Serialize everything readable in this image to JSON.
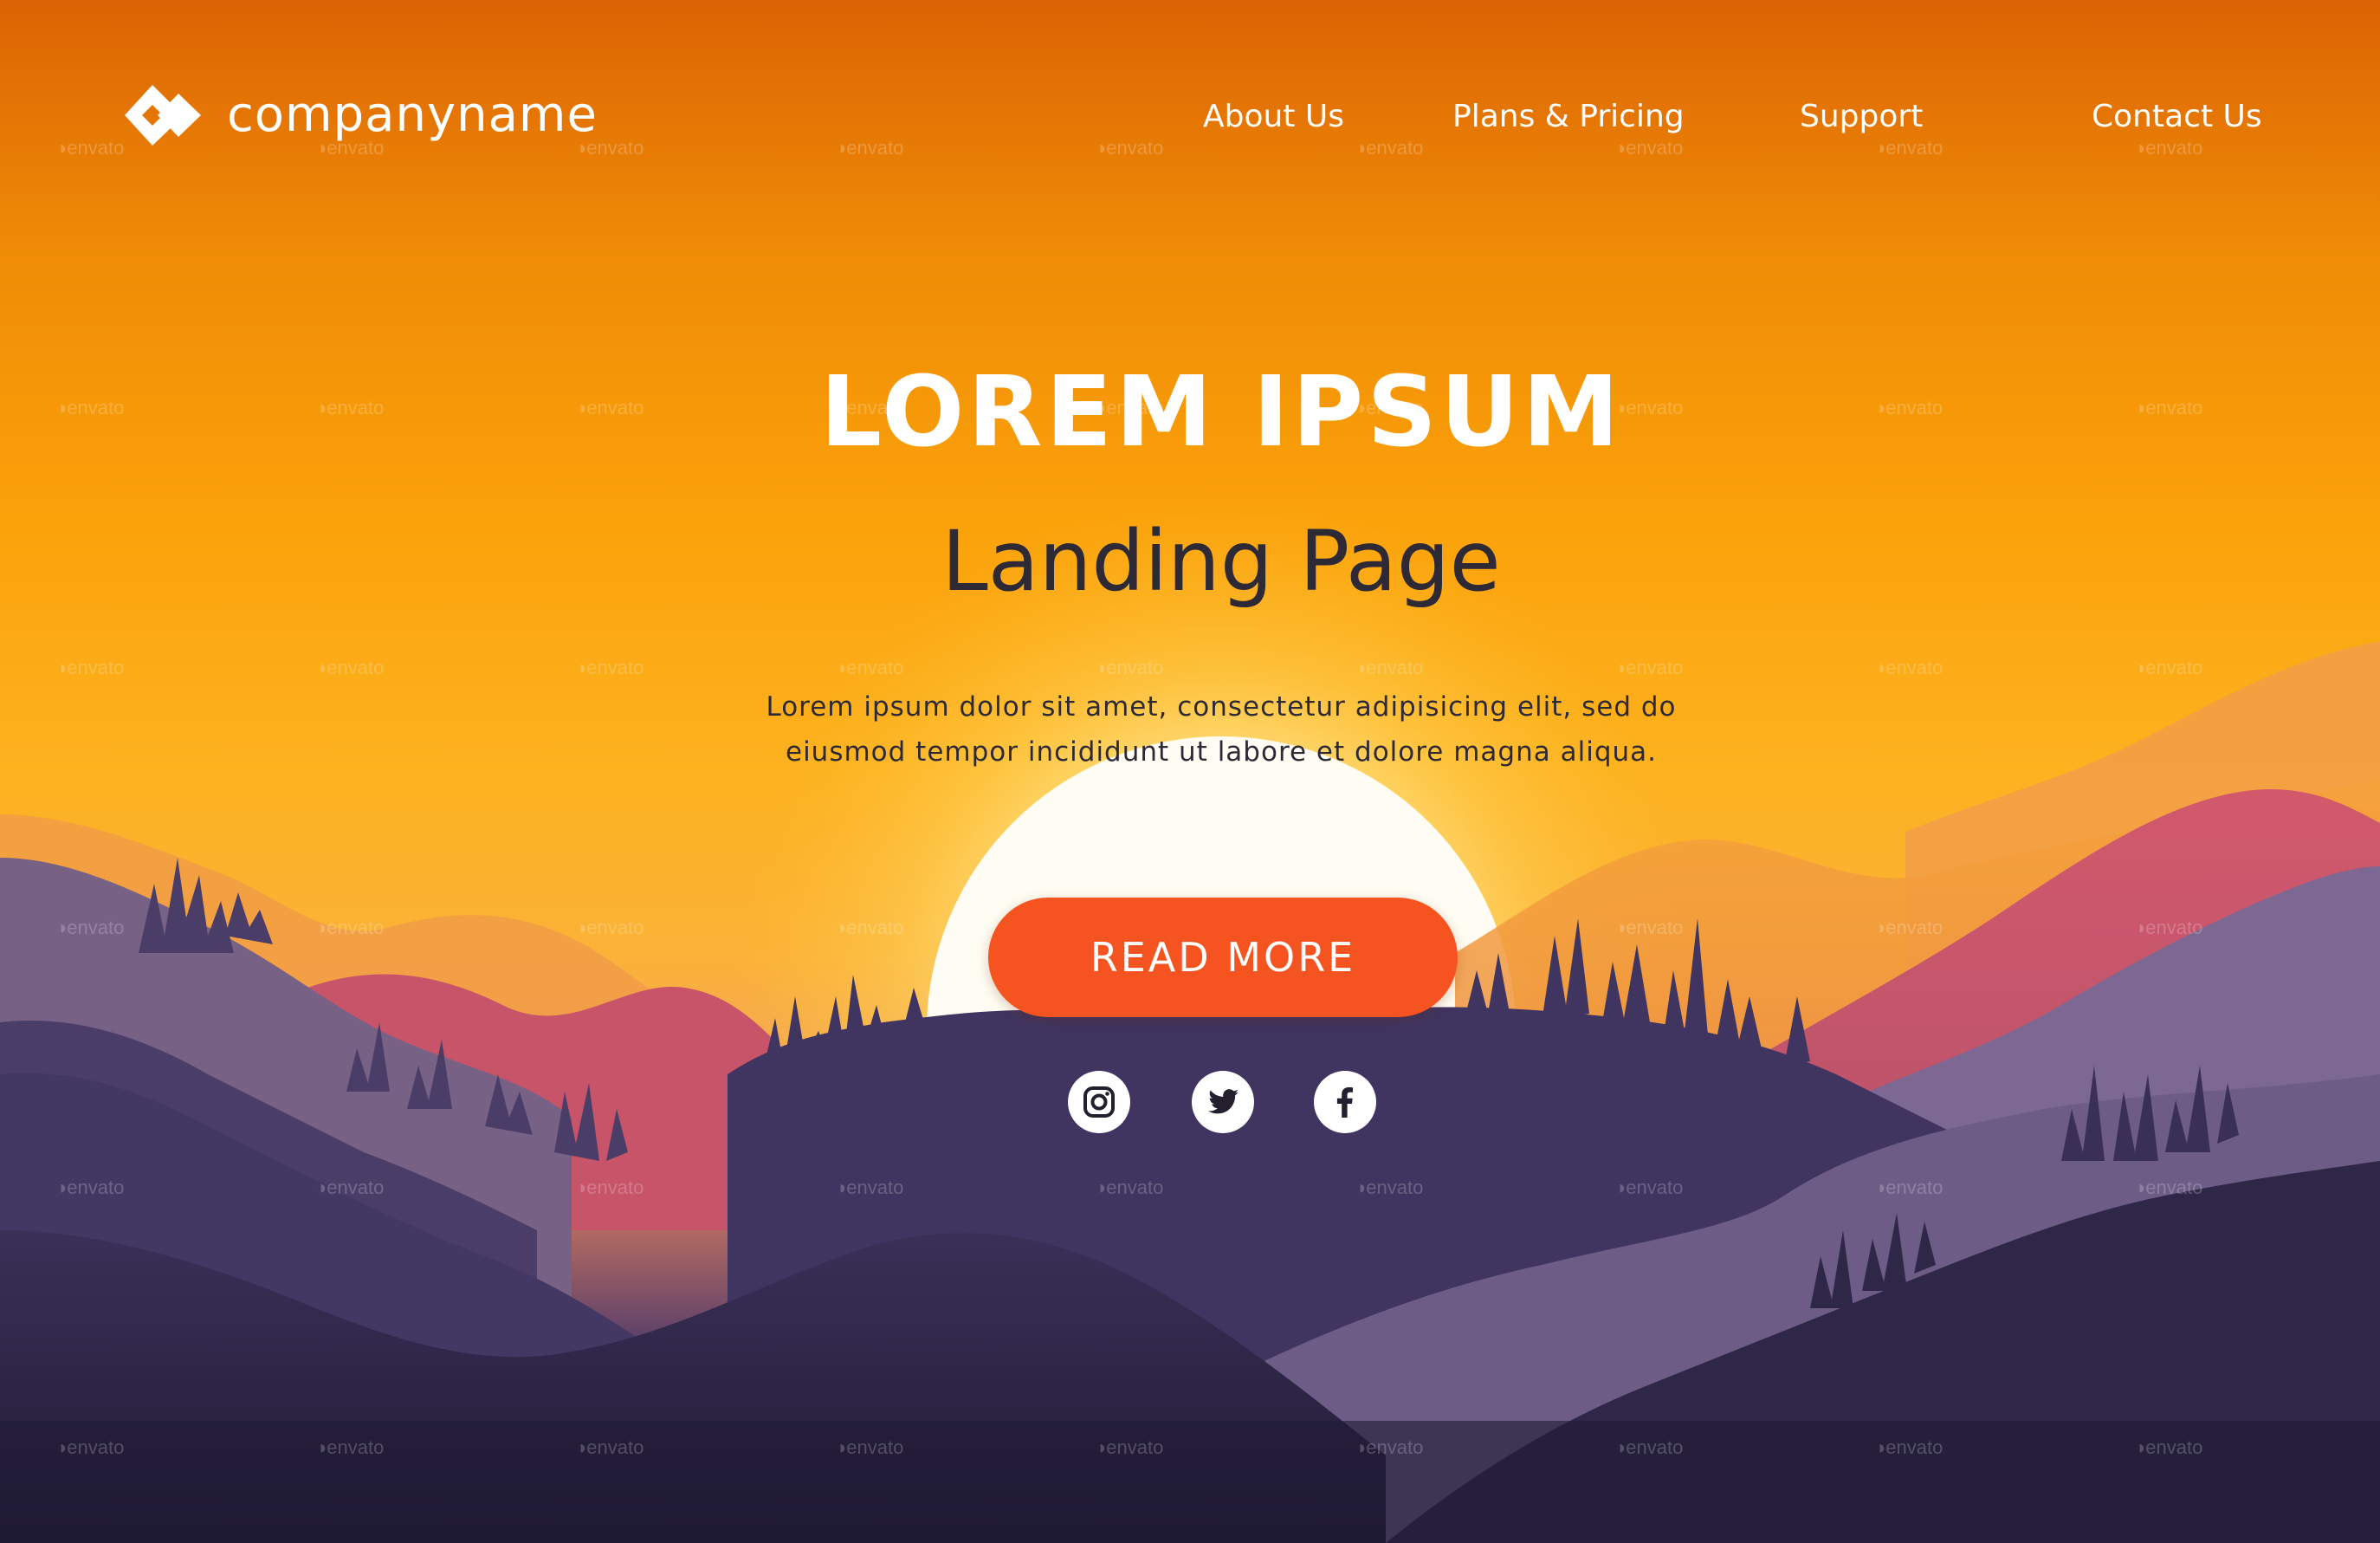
{
  "brand": {
    "name": "companyname",
    "logo_icon": "double-diamond-logo-icon"
  },
  "nav": {
    "items": [
      {
        "label": "About Us"
      },
      {
        "label": "Plans & Pricing"
      },
      {
        "label": "Support"
      },
      {
        "label": "Contact Us"
      }
    ]
  },
  "hero": {
    "title": "LOREM IPSUM",
    "subtitle": "Landing Page",
    "description": "Lorem ipsum dolor sit amet, consectetur adipisicing elit, sed do eiusmod tempor incididunt ut labore et dolore magna aliqua.",
    "cta_label": "READ MORE"
  },
  "social": [
    {
      "icon": "instagram-icon"
    },
    {
      "icon": "twitter-icon"
    },
    {
      "icon": "facebook-icon"
    }
  ],
  "watermark": {
    "text": "envato"
  },
  "colors": {
    "sky_top": "#dc6304",
    "sky_mid": "#fba20a",
    "sun": "#fffbe8",
    "cta": "#f55421",
    "mountain_dark": "#3d325c",
    "mountain_pink": "#c9586a",
    "text_dark": "#2d2a36",
    "text_light": "#ffffff"
  }
}
